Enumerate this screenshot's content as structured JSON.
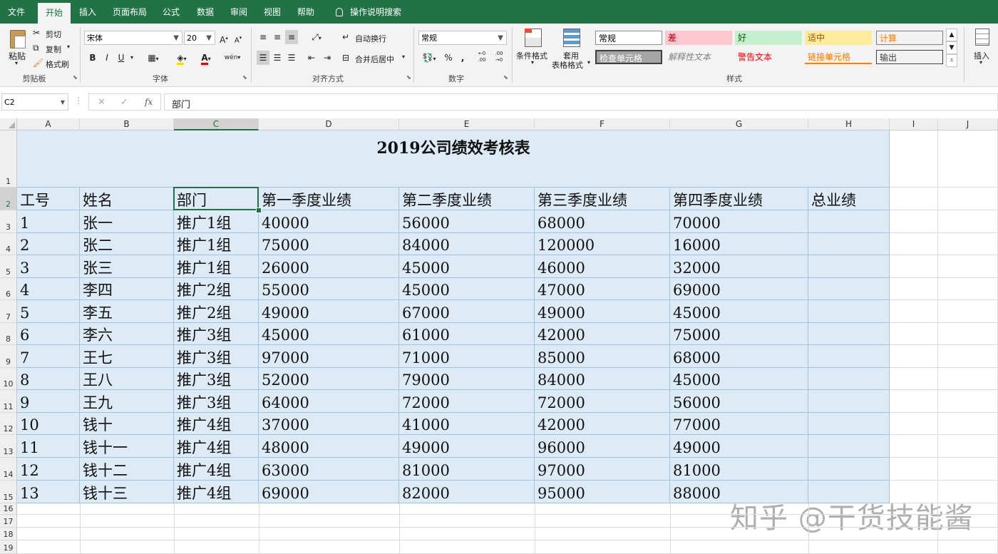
{
  "tabs": [
    "文件",
    "开始",
    "插入",
    "页面布局",
    "公式",
    "数据",
    "审阅",
    "视图",
    "帮助",
    "操作说明搜索"
  ],
  "clipboard": {
    "paste": "粘贴",
    "cut": "剪切",
    "copy": "复制",
    "format_painter": "格式刷",
    "group": "剪贴板"
  },
  "font": {
    "name": "宋体",
    "size": "20",
    "bold": "B",
    "italic": "I",
    "underline": "U",
    "group": "字体",
    "pinyin": "wén"
  },
  "alignment": {
    "wrap": "自动换行",
    "merge": "合并后居中",
    "group": "对齐方式"
  },
  "number": {
    "format": "常规",
    "percent": "%",
    "comma": ",",
    "group": "数字",
    "inc_dec": "←0 .00",
    "dec_dec": ".00 →0"
  },
  "styles": {
    "cond_format": "条件格式",
    "table_format_1": "套用",
    "table_format_2": "表格格式",
    "group": "样式",
    "cells": [
      "常规",
      "差",
      "好",
      "适中",
      "计算",
      "检查单元格",
      "解释性文本",
      "警告文本",
      "链接单元格",
      "输出"
    ]
  },
  "insert": {
    "label": "插入"
  },
  "formula_bar": {
    "name_box": "C2",
    "fx": "fx",
    "value": "部门"
  },
  "columns": [
    "A",
    "B",
    "C",
    "D",
    "E",
    "F",
    "G",
    "H",
    "I",
    "J"
  ],
  "rows": [
    "1",
    "2",
    "3",
    "4",
    "5",
    "6",
    "7",
    "8",
    "9",
    "10",
    "11",
    "12",
    "13",
    "14",
    "15",
    "16",
    "17",
    "18",
    "19"
  ],
  "sheet": {
    "title": "2019公司绩效考核表",
    "headers": [
      "工号",
      "姓名",
      "部门",
      "第一季度业绩",
      "第二季度业绩",
      "第三季度业绩",
      "第四季度业绩",
      "总业绩"
    ],
    "data": [
      [
        "1",
        "张一",
        "推广1组",
        "40000",
        "56000",
        "68000",
        "70000",
        ""
      ],
      [
        "2",
        "张二",
        "推广1组",
        "75000",
        "84000",
        "120000",
        "16000",
        ""
      ],
      [
        "3",
        "张三",
        "推广1组",
        "26000",
        "45000",
        "46000",
        "32000",
        ""
      ],
      [
        "4",
        "李四",
        "推广2组",
        "55000",
        "45000",
        "47000",
        "69000",
        ""
      ],
      [
        "5",
        "李五",
        "推广2组",
        "49000",
        "67000",
        "49000",
        "45000",
        ""
      ],
      [
        "6",
        "李六",
        "推广3组",
        "45000",
        "61000",
        "42000",
        "75000",
        ""
      ],
      [
        "7",
        "王七",
        "推广3组",
        "97000",
        "71000",
        "85000",
        "68000",
        ""
      ],
      [
        "8",
        "王八",
        "推广3组",
        "52000",
        "79000",
        "84000",
        "45000",
        ""
      ],
      [
        "9",
        "王九",
        "推广3组",
        "64000",
        "72000",
        "72000",
        "56000",
        ""
      ],
      [
        "10",
        "钱十",
        "推广4组",
        "37000",
        "41000",
        "42000",
        "77000",
        ""
      ],
      [
        "11",
        "钱十一",
        "推广4组",
        "48000",
        "49000",
        "96000",
        "49000",
        ""
      ],
      [
        "12",
        "钱十二",
        "推广4组",
        "63000",
        "81000",
        "97000",
        "81000",
        ""
      ],
      [
        "13",
        "钱十三",
        "推广4组",
        "69000",
        "82000",
        "95000",
        "88000",
        ""
      ]
    ]
  },
  "watermark": "知乎 @干货技能酱",
  "colors": {
    "accent": "#217346",
    "table_fill": "#ddebf7",
    "table_border": "#9dc3e6"
  }
}
